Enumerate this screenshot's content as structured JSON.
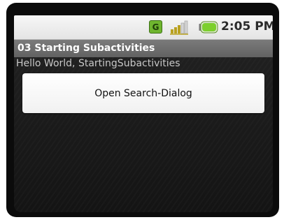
{
  "statusbar": {
    "network_badge": "G",
    "signal_icon": "signal-strength-icon",
    "battery_icon": "battery-icon",
    "time": "2:05 PM"
  },
  "app": {
    "title": "03 Starting Subactivities",
    "hello_text": "Hello World, StartingSubactivities",
    "button_label": "Open Search-Dialog"
  },
  "colors": {
    "title_bar": "#6b6b6b",
    "network_badge": "#6fb52f",
    "battery_fill": "#7ccf2c"
  }
}
